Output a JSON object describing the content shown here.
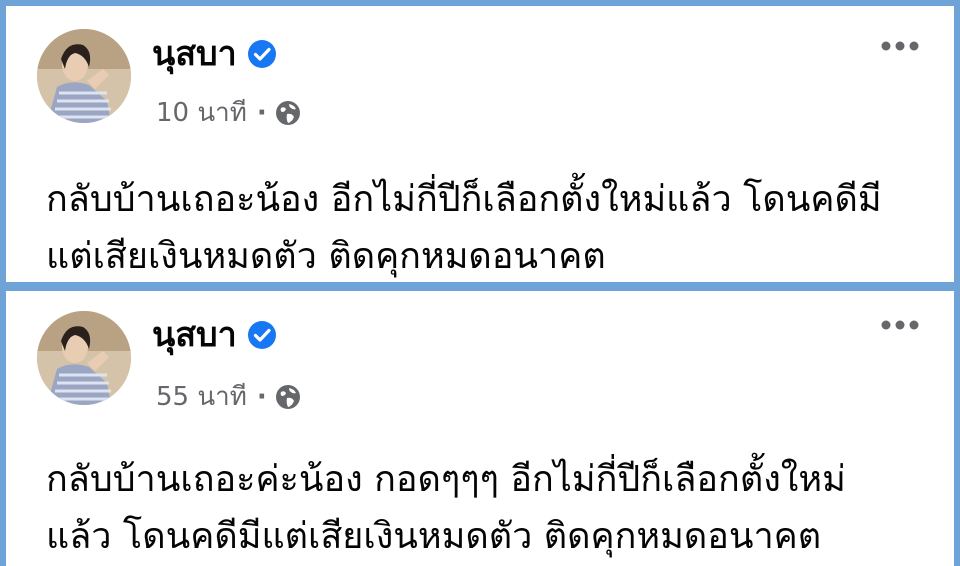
{
  "colors": {
    "frame_blue": "#6fa3d8",
    "card_bg": "#ffffff",
    "verified_blue": "#1877f2",
    "meta_gray": "#65676b",
    "text_black": "#050505"
  },
  "posts": [
    {
      "author": "นุสบา",
      "verified": true,
      "time": "10 นาที",
      "separator": "·",
      "privacy_icon": "globe-icon",
      "more_icon": "more-options-icon",
      "text": "กลับบ้านเถอะน้อง อีกไม่กี่ปีก็เลือกตั้งใหม่แล้ว โดนคดีมี\nแต่เสียเงินหมดตัว ติดคุกหมดอนาคต"
    },
    {
      "author": "นุสบา",
      "verified": true,
      "time": "55 นาที",
      "separator": "·",
      "privacy_icon": "globe-icon",
      "more_icon": "more-options-icon",
      "text": "กลับบ้านเถอะค่ะน้อง กอดๆๆๆ อีกไม่กี่ปีก็เลือกตั้งใหม่\nแล้ว โดนคดีมีแต่เสียเงินหมดตัว ติดคุกหมดอนาคต"
    }
  ]
}
